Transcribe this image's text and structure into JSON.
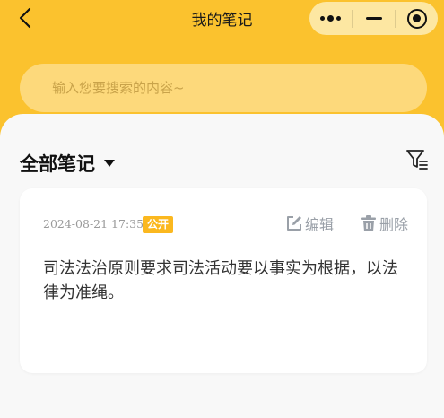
{
  "header": {
    "title": "我的笔记",
    "back_icon": "chevron-left-icon",
    "capsule": {
      "more_icon": "more-dots-icon",
      "minimize_icon": "minus-icon",
      "close_icon": "target-icon"
    }
  },
  "search": {
    "placeholder": "输入您要搜索的内容~",
    "value": ""
  },
  "section": {
    "title": "全部笔记",
    "dropdown_icon": "caret-down-icon",
    "filter_icon": "filter-icon"
  },
  "notes": [
    {
      "date": "2024-08-21 17:35",
      "badge": "公开",
      "edit_label": "编辑",
      "delete_label": "删除",
      "text": "司法法治原则要求司法活动要以事实为根据，以法律为准绳。"
    }
  ],
  "colors": {
    "brand_yellow": "#fbc22e",
    "search_bg": "#fdd97b",
    "badge": "#fbb81f",
    "action_gray": "#9aa0a8"
  }
}
